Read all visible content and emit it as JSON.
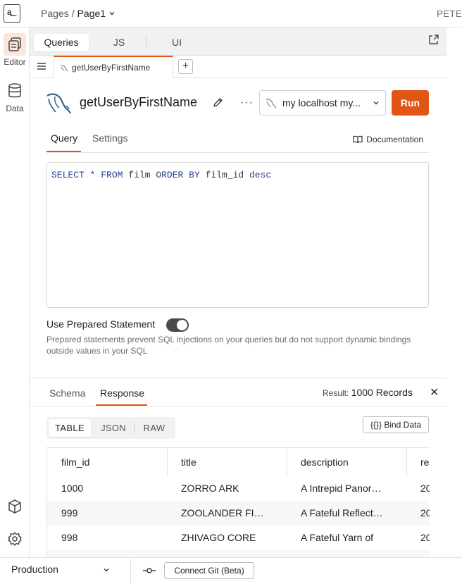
{
  "header": {
    "logo": "a_",
    "breadcrumb_root": "Pages",
    "breadcrumb_sep": "/",
    "breadcrumb_page": "Page1",
    "user": "PETE"
  },
  "sidebar": {
    "editor_label": "Editor",
    "data_label": "Data"
  },
  "editor_tabs": {
    "queries": "Queries",
    "js": "JS",
    "ui": "UI"
  },
  "file_tab": {
    "name": "getUserByFirstName",
    "add": "+"
  },
  "query": {
    "title": "getUserByFirstName",
    "more": "···",
    "datasource": "my localhost my...",
    "run_label": "Run",
    "tab_query": "Query",
    "tab_settings": "Settings",
    "documentation": "Documentation",
    "sql_parts": {
      "select": "SELECT",
      "star": "*",
      "from": "FROM",
      "table": "film",
      "order": "ORDER",
      "by": "BY",
      "column": "film_id",
      "dir": "desc"
    },
    "prepared_label": "Use Prepared Statement",
    "prepared_on": true,
    "prepared_desc": "Prepared statements prevent SQL injections on your queries but do not support dynamic bindings outside values in your SQL"
  },
  "response": {
    "tab_schema": "Schema",
    "tab_response": "Response",
    "result_label": "Result:",
    "result_count": "1000 Records",
    "close": "✕",
    "view_table": "TABLE",
    "view_json": "JSON",
    "view_raw": "RAW",
    "bind_data": "{{}} Bind Data",
    "columns": [
      "film_id",
      "title",
      "description",
      "re"
    ],
    "rows": [
      [
        "1000",
        "ZORRO ARK",
        "A Intrepid Panorama",
        "20"
      ],
      [
        "999",
        "ZOOLANDER FICTION",
        "A Fateful Reflection",
        "20"
      ],
      [
        "998",
        "ZHIVAGO CORE",
        "A Fateful Yarn of",
        "20"
      ]
    ]
  },
  "footer": {
    "environment": "Production",
    "connect_git": "Connect Git (Beta)"
  },
  "colors": {
    "accent": "#e15615",
    "active_bg": "#fbe6dc",
    "sql_keyword": "#2a3f8f"
  }
}
